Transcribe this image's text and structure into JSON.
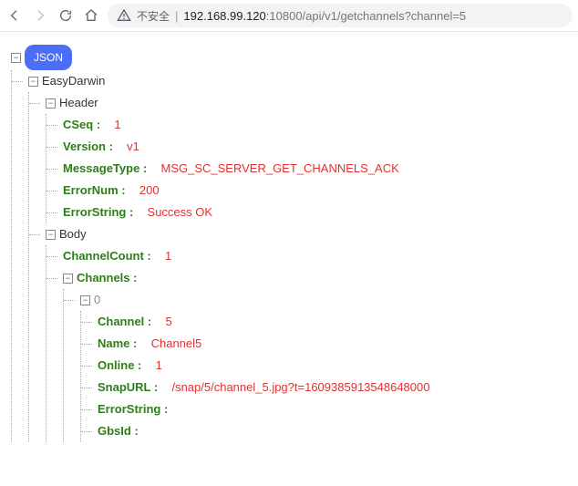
{
  "toolbar": {
    "insecure_label": "不安全",
    "url_host": "192.168.99.120",
    "url_port": ":10800",
    "url_path": "/api/v1/getchannels?channel=5"
  },
  "json_badge": "JSON",
  "root_label": "EasyDarwin",
  "header_label": "Header",
  "body_label": "Body",
  "header_fields": {
    "CSeq_key": "CSeq :",
    "CSeq_val": "1",
    "Version_key": "Version :",
    "Version_val": "v1",
    "MessageType_key": "MessageType :",
    "MessageType_val": "MSG_SC_SERVER_GET_CHANNELS_ACK",
    "ErrorNum_key": "ErrorNum :",
    "ErrorNum_val": "200",
    "ErrorString_key": "ErrorString :",
    "ErrorString_val": "Success OK"
  },
  "body_fields": {
    "ChannelCount_key": "ChannelCount :",
    "ChannelCount_val": "1",
    "Channels_key": "Channels :"
  },
  "channel_index_label": "0",
  "channel_fields": {
    "Channel_key": "Channel :",
    "Channel_val": "5",
    "Name_key": "Name :",
    "Name_val": "Channel5",
    "Online_key": "Online :",
    "Online_val": "1",
    "SnapURL_key": "SnapURL :",
    "SnapURL_val": "/snap/5/channel_5.jpg?t=1609385913548648000",
    "ErrorString_key": "ErrorString :",
    "GbsId_key": "GbsId :"
  }
}
